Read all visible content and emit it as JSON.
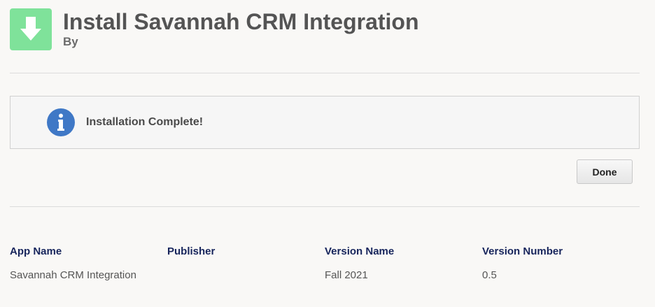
{
  "header": {
    "title": "Install Savannah CRM Integration",
    "by_label": "By",
    "icon": "download-arrow-icon"
  },
  "message": {
    "icon": "info-icon",
    "text": "Installation Complete!"
  },
  "actions": {
    "done_label": "Done"
  },
  "details": {
    "columns": [
      "App Name",
      "Publisher",
      "Version Name",
      "Version Number"
    ],
    "values": [
      "Savannah CRM Integration",
      "",
      "Fall 2021",
      "0.5"
    ]
  },
  "colors": {
    "icon_bg": "#7fe29a",
    "info_blue": "#3f78c6",
    "header_text": "#17255c"
  }
}
